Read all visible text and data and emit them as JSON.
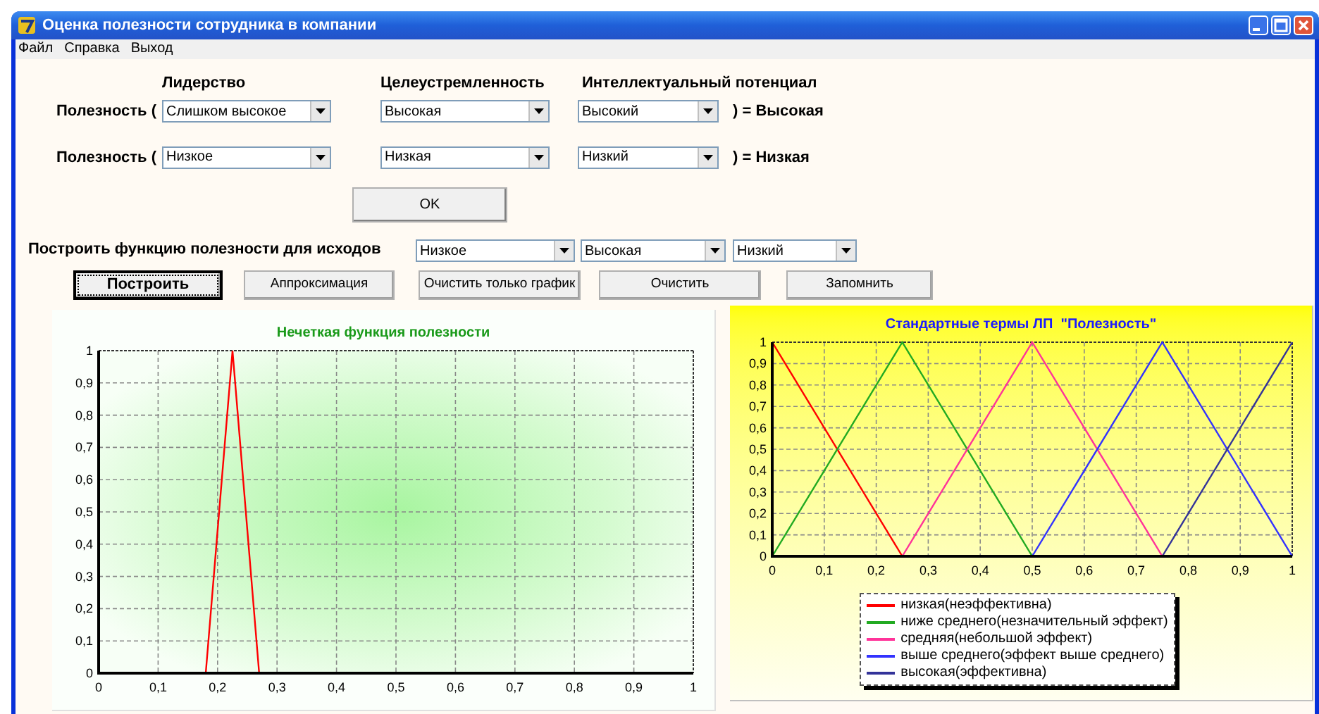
{
  "window": {
    "title": "Оценка полезности сотрудника в компании"
  },
  "menu": [
    "Файл",
    "Справка",
    "Выход"
  ],
  "column_headers": [
    "Лидерство",
    "Целеустремленность",
    "Интеллектуальный потенциал"
  ],
  "rules": [
    {
      "prefix": "Полезность (",
      "values": [
        "Слишком высокое",
        "Высокая",
        "Высокий"
      ],
      "result": ") = Высокая"
    },
    {
      "prefix": "Полезность (",
      "values": [
        "Низкое",
        "Низкая",
        "Низкий"
      ],
      "result": ") = Низкая"
    }
  ],
  "ok_button": "OK",
  "outcomes": {
    "label": "Построить функцию полезности для исходов",
    "values": [
      "Низкое",
      "Высокая",
      "Низкий"
    ]
  },
  "buttons": [
    {
      "label": "Построить",
      "focused": true
    },
    {
      "label": "Аппроксимация",
      "focused": false
    },
    {
      "label": "Очистить только график",
      "focused": false
    },
    {
      "label": "Очистить",
      "focused": false
    },
    {
      "label": "Запомнить",
      "focused": false
    }
  ],
  "fuzzy_chart": {
    "chart_data": {
      "type": "line",
      "grid": true,
      "title": "Нечеткая функция полезности",
      "x": [
        0.18,
        0.225,
        0.27
      ],
      "xlim": [
        0,
        1
      ],
      "ylim": [
        0,
        1
      ],
      "xticks": [
        {
          "value": 0,
          "label": "0"
        },
        {
          "value": 0.1,
          "label": "0,1"
        },
        {
          "value": 0.2,
          "label": "0,2"
        },
        {
          "value": 0.3,
          "label": "0,3"
        },
        {
          "value": 0.4,
          "label": "0,4"
        },
        {
          "value": 0.5,
          "label": "0,5"
        },
        {
          "value": 0.6,
          "label": "0,6"
        },
        {
          "value": 0.7,
          "label": "0,7"
        },
        {
          "value": 0.8,
          "label": "0,8"
        },
        {
          "value": 0.9,
          "label": "0,9"
        },
        {
          "value": 1,
          "label": "1"
        }
      ],
      "yticks": [
        {
          "value": 0,
          "label": "0"
        },
        {
          "value": 0.1,
          "label": "0,1"
        },
        {
          "value": 0.2,
          "label": "0,2"
        },
        {
          "value": 0.3,
          "label": "0,3"
        },
        {
          "value": 0.4,
          "label": "0,4"
        },
        {
          "value": 0.5,
          "label": "0,5"
        },
        {
          "value": 0.6,
          "label": "0,6"
        },
        {
          "value": 0.7,
          "label": "0,7"
        },
        {
          "value": 0.8,
          "label": "0,8"
        },
        {
          "value": 0.9,
          "label": "0,9"
        },
        {
          "value": 1,
          "label": "1"
        }
      ],
      "series": [
        {
          "color": "#ff0000",
          "values": [
            0,
            1,
            0
          ]
        }
      ]
    }
  },
  "terms_chart": {
    "chart_data": {
      "type": "line",
      "grid": true,
      "title": "Стандартные термы ЛП  \"Полезность\"",
      "x": [
        0,
        0.25,
        0.5,
        0.75,
        1
      ],
      "xlim": [
        0,
        1
      ],
      "ylim": [
        0,
        1
      ],
      "xticks": [
        {
          "value": 0,
          "label": "0"
        },
        {
          "value": 0.1,
          "label": "0,1"
        },
        {
          "value": 0.2,
          "label": "0,2"
        },
        {
          "value": 0.3,
          "label": "0,3"
        },
        {
          "value": 0.4,
          "label": "0,4"
        },
        {
          "value": 0.5,
          "label": "0,5"
        },
        {
          "value": 0.6,
          "label": "0,6"
        },
        {
          "value": 0.7,
          "label": "0,7"
        },
        {
          "value": 0.8,
          "label": "0,8"
        },
        {
          "value": 0.9,
          "label": "0,9"
        },
        {
          "value": 1,
          "label": "1"
        }
      ],
      "yticks": [
        {
          "value": 0,
          "label": "0"
        },
        {
          "value": 0.1,
          "label": "0,1"
        },
        {
          "value": 0.2,
          "label": "0,2"
        },
        {
          "value": 0.3,
          "label": "0,3"
        },
        {
          "value": 0.4,
          "label": "0,4"
        },
        {
          "value": 0.5,
          "label": "0,5"
        },
        {
          "value": 0.6,
          "label": "0,6"
        },
        {
          "value": 0.7,
          "label": "0,7"
        },
        {
          "value": 0.8,
          "label": "0,8"
        },
        {
          "value": 0.9,
          "label": "0,9"
        },
        {
          "value": 1,
          "label": "1"
        }
      ],
      "series": [
        {
          "name": "низкая(неэффективна)",
          "color": "#ff0000",
          "values": [
            1,
            0,
            null,
            null,
            null
          ]
        },
        {
          "name": "ниже среднего(незначительный эффект)",
          "color": "#22aa22",
          "values": [
            0,
            1,
            0,
            null,
            null
          ]
        },
        {
          "name": "средняя(небольшой эффект)",
          "color": "#ff3399",
          "values": [
            null,
            0,
            1,
            0,
            null
          ]
        },
        {
          "name": "выше среднего(эффект выше среднего)",
          "color": "#3333ff",
          "values": [
            null,
            null,
            0,
            1,
            0
          ]
        },
        {
          "name": "высокая(эффективна)",
          "color": "#333399",
          "values": [
            null,
            null,
            null,
            0,
            1
          ]
        }
      ]
    }
  }
}
